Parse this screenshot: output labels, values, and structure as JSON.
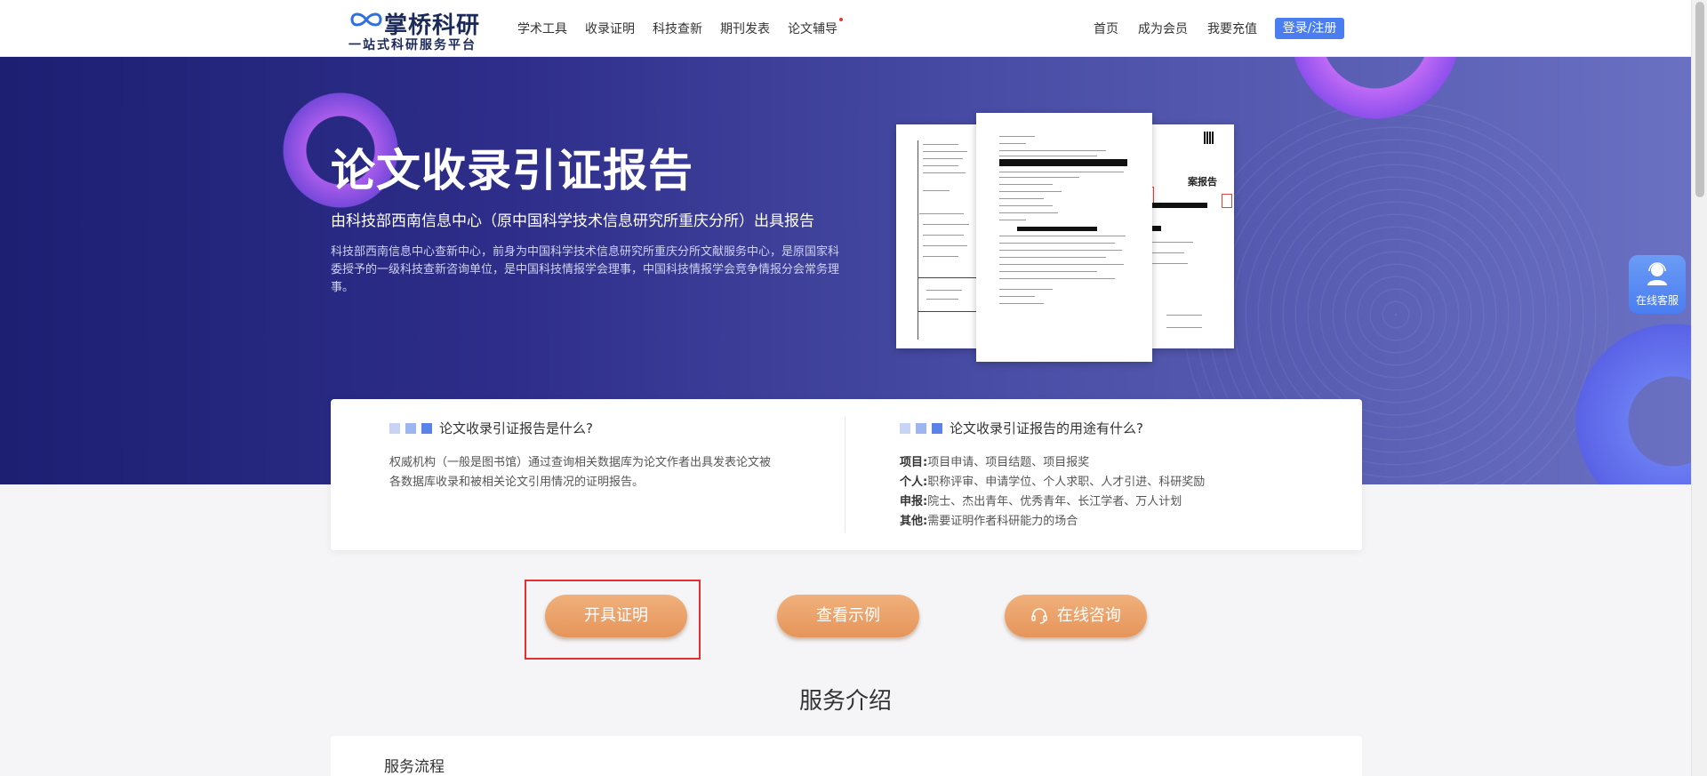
{
  "header": {
    "logo_title": "掌桥科研",
    "logo_subtitle": "一站式科研服务平台",
    "nav": [
      "学术工具",
      "收录证明",
      "科技查新",
      "期刊发表",
      "论文辅导"
    ],
    "right_nav": [
      "首页",
      "成为会员",
      "我要充值"
    ],
    "login_label": "登录/注册"
  },
  "hero": {
    "title": "论文收录引证报告",
    "subtitle": "由科技部西南信息中心（原中国科学技术信息研究所重庆分所）出具报告",
    "description": "科技部西南信息中心查新中心，前身为中国科学技术信息研究所重庆分所文献服务中心，是原国家科委授予的一级科技查新咨询单位，是中国科技情报学会理事，中国科技情报学会竞争情报分会常务理事。",
    "doc_heading": "案报告"
  },
  "info": {
    "left_heading": "论文收录引证报告是什么?",
    "left_text": "权威机构（一般是图书馆）通过查询相关数据库为论文作者出具发表论文被各数据库收录和被相关论文引用情况的证明报告。",
    "right_heading": "论文收录引证报告的用途有什么?",
    "uses": [
      {
        "key": "项目:",
        "value": "项目申请、项目结题、项目报奖"
      },
      {
        "key": "个人:",
        "value": "职称评审、申请学位、个人求职、人才引进、科研奖励"
      },
      {
        "key": "申报:",
        "value": "院士、杰出青年、优秀青年、长江学者、万人计划"
      },
      {
        "key": "其他:",
        "value": "需要证明作者科研能力的场合"
      }
    ]
  },
  "buttons": {
    "issue": "开具证明",
    "example": "查看示例",
    "consult": "在线咨询"
  },
  "service": {
    "title": "服务介绍",
    "flow": "服务流程"
  },
  "float": {
    "label": "在线客服"
  },
  "colors": {
    "accent": "#4a7df0",
    "button": "#e5955a",
    "highlight": "#e53030",
    "hero_dark": "#1c1f72"
  }
}
